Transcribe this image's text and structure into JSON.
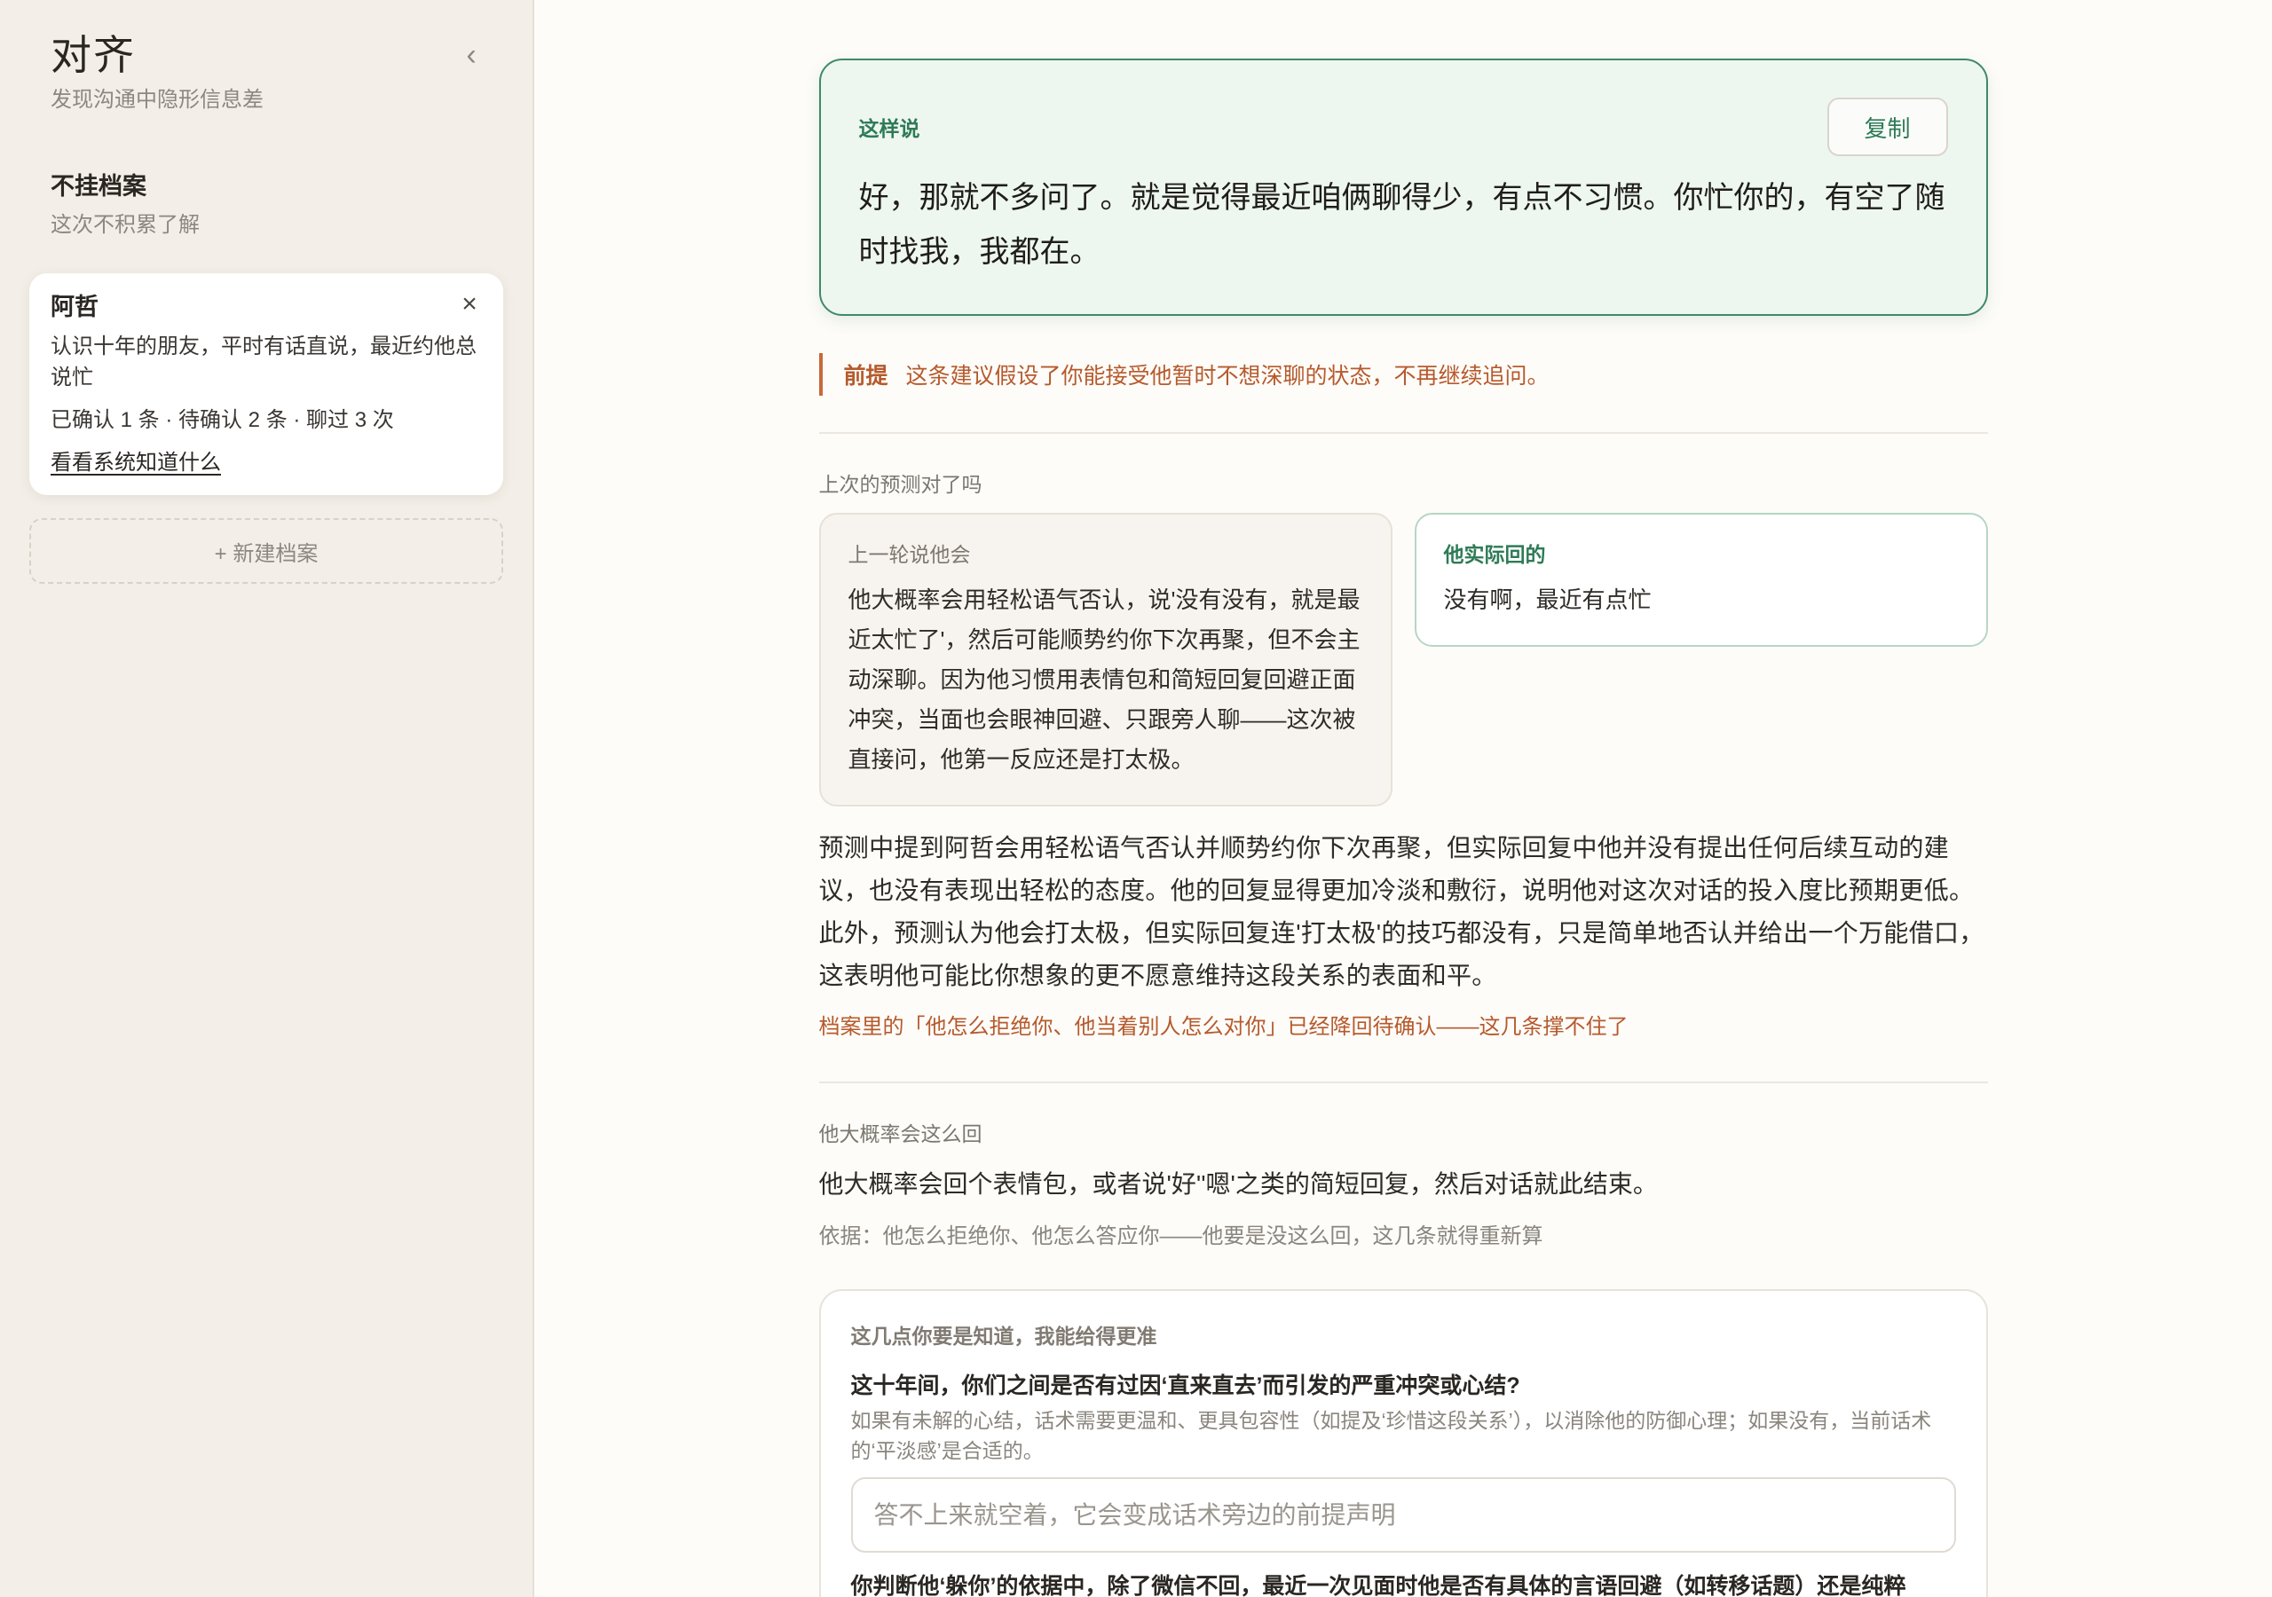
{
  "app": {
    "title": "对齐",
    "subtitle": "发现沟通中隐形信息差"
  },
  "icons": {
    "collapse": "chevron-left-icon",
    "close_profile": "close-icon"
  },
  "sidebar": {
    "no_profile": {
      "title": "不挂档案",
      "subtitle": "这次不积累了解"
    },
    "profiles": [
      {
        "name": "阿哲",
        "description": "认识十年的朋友，平时有话直说，最近约他总说忙",
        "stats": "已确认 1 条 · 待确认 2 条 · 聊过 3 次",
        "link": "看看系统知道什么"
      }
    ],
    "new_profile_label": "+ 新建档案"
  },
  "suggestion": {
    "label": "这样说",
    "copy_label": "复制",
    "text": "好，那就不多问了。就是觉得最近咱俩聊得少，有点不习惯。你忙你的，有空了随时找我，我都在。"
  },
  "premise": {
    "label": "前提",
    "text": "这条建议假设了你能接受他暂时不想深聊的状态，不再继续追问。"
  },
  "prediction_check": {
    "heading": "上次的预测对了吗",
    "predicted": {
      "label": "上一轮说他会",
      "text": "他大概率会用轻松语气否认，说'没有没有，就是最近太忙了'，然后可能顺势约你下次再聚，但不会主动深聊。因为他习惯用表情包和简短回复回避正面冲突，当面也会眼神回避、只跟旁人聊——这次被直接问，他第一反应还是打太极。"
    },
    "actual": {
      "label": "他实际回的",
      "text": "没有啊，最近有点忙"
    },
    "analysis": "预测中提到阿哲会用轻松语气否认并顺势约你下次再聚，但实际回复中他并没有提出任何后续互动的建议，也没有表现出轻松的态度。他的回复显得更加冷淡和敷衍，说明他对这次对话的投入度比预期更低。此外，预测认为他会打太极，但实际回复连'打太极'的技巧都没有，只是简单地否认并给出一个万能借口，这表明他可能比你想象的更不愿意维持这段关系的表面和平。",
    "note": "档案里的「他怎么拒绝你、他当着别人怎么对你」已经降回待确认——这几条撑不住了"
  },
  "next_reply": {
    "heading": "他大概率会这么回",
    "text": "他大概率会回个表情包，或者说'好''嗯'之类的简短回复，然后对话就此结束。",
    "basis": "依据：他怎么拒绝你、他怎么答应你——他要是没这么回，这几条就得重新算"
  },
  "questions": {
    "heading": "这几点你要是知道，我能给得更准",
    "items": [
      {
        "question": "这十年间，你们之间是否有过因‘直来直去’而引发的严重冲突或心结?",
        "hint": "如果有未解的心结，话术需要更温和、更具包容性（如提及‘珍惜这段关系’），以消除他的防御心理；如果没有，当前话术的‘平淡感’是合适的。",
        "placeholder": "答不上来就空着，它会变成话术旁边的前提声明",
        "value": ""
      },
      {
        "question": "你判断他‘躲你’的依据中，除了微信不回，最近一次见面时他是否有具体的言语回避（如转移话题）还是纯粹"
      }
    ]
  },
  "colors": {
    "accent_green": "#2e7b56",
    "suggestion_bg": "#eef6f0",
    "warning_orange": "#b65a2c",
    "sidebar_bg": "#f3efe8",
    "page_bg": "#fdfcf9"
  }
}
